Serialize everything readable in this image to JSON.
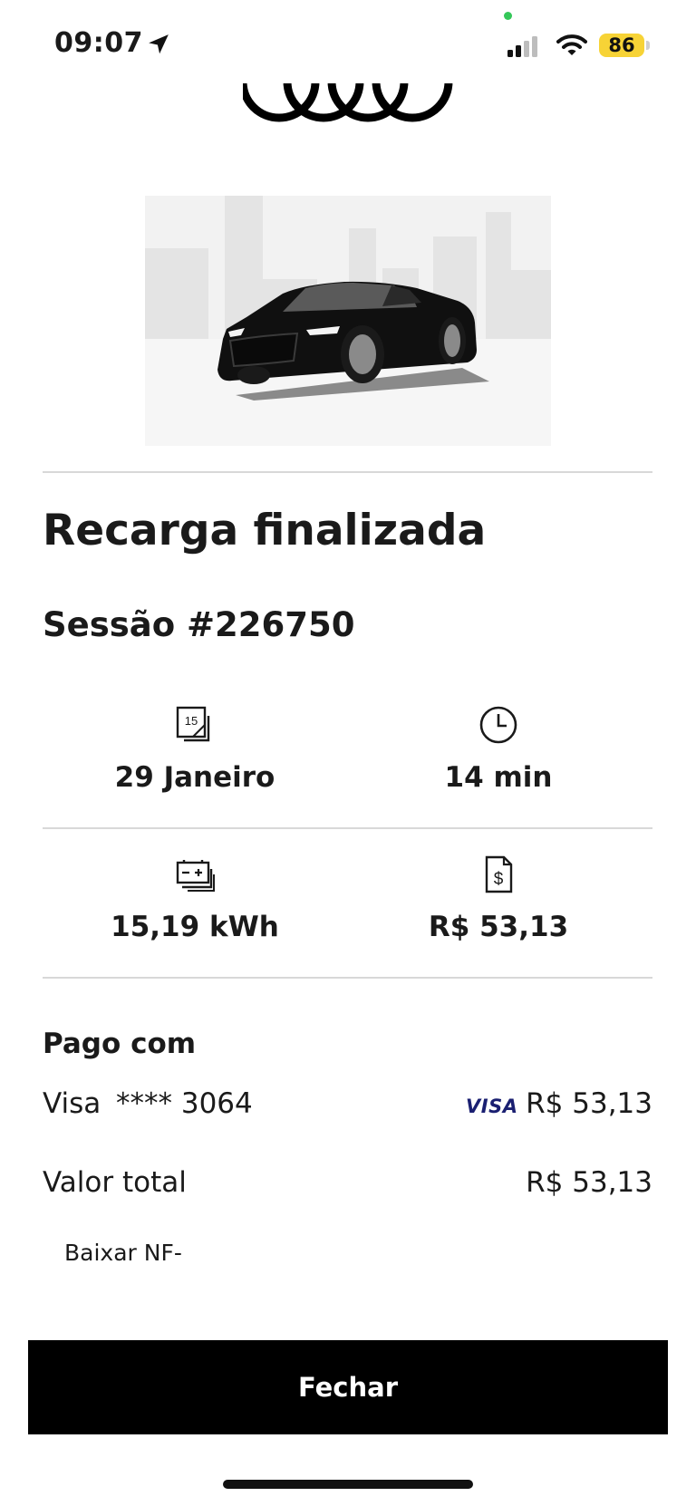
{
  "status_bar": {
    "time": "09:07",
    "battery": "86"
  },
  "session": {
    "title": "Recarga finalizada",
    "subtitle": "Sessão #226750"
  },
  "stats": {
    "date": "29 Janeiro",
    "duration": "14 min",
    "energy": "15,19 kWh",
    "cost": "R$ 53,13",
    "calendar_icon_number": "15"
  },
  "payment": {
    "heading": "Pago com",
    "method": "Visa",
    "card_masked": "**** 3064",
    "card_brand": "VISA",
    "amount": "R$ 53,13",
    "total_label": "Valor total",
    "total_value": "R$ 53,13"
  },
  "download_link": "Baixar NF-",
  "close_button": "Fechar",
  "icons": {
    "location": "location-arrow-icon",
    "signal": "cellular-signal-icon",
    "wifi": "wifi-icon",
    "calendar": "calendar-icon",
    "clock": "clock-icon",
    "battery": "battery-charge-icon",
    "invoice": "invoice-dollar-icon"
  },
  "colors": {
    "button_bg": "#000000",
    "visa_blue": "#1a1f71",
    "battery_yellow": "#f7d336",
    "status_green": "#34c759"
  }
}
